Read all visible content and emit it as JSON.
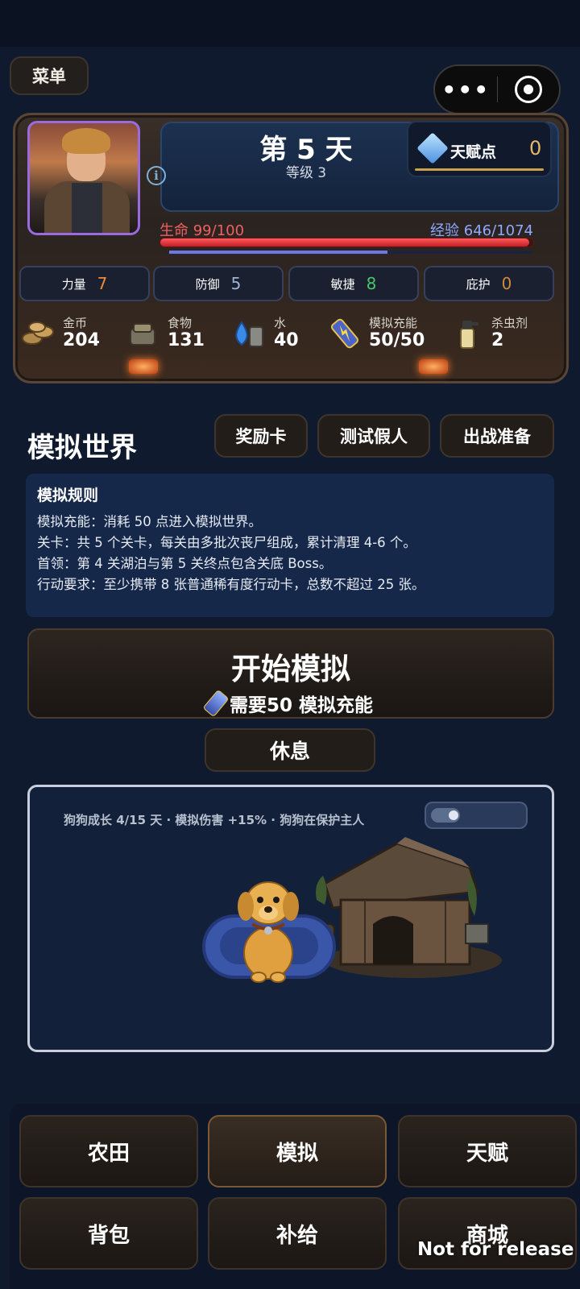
{
  "header": {
    "menu_label": "菜单"
  },
  "player": {
    "day": "第 5 天",
    "level": "等级 3",
    "talent_label": "天赋点",
    "talent_value": "0",
    "hp_label": "生命 99/100",
    "xp_label": "经验 646/1074",
    "hp_current": 99,
    "hp_max": 100,
    "xp_current": 646,
    "xp_max": 1074
  },
  "stats": [
    {
      "label": "力量",
      "value": "7",
      "color": "#f08a3a"
    },
    {
      "label": "防御",
      "value": "5",
      "color": "#9fb4d6"
    },
    {
      "label": "敏捷",
      "value": "8",
      "color": "#4ac46a"
    },
    {
      "label": "庇护",
      "value": "0",
      "color": "#d08a3a"
    }
  ],
  "resources": [
    {
      "label": "金币",
      "value": "204",
      "icon": "coins-icon"
    },
    {
      "label": "食物",
      "value": "131",
      "icon": "food-icon"
    },
    {
      "label": "水",
      "value": "40",
      "icon": "water-icon"
    },
    {
      "label": "模拟充能",
      "value": "50/50",
      "icon": "battery-icon"
    },
    {
      "label": "杀虫剂",
      "value": "2",
      "icon": "spray-icon"
    }
  ],
  "section": {
    "title": "模拟世界",
    "buttons": [
      "奖励卡",
      "测试假人",
      "出战准备"
    ]
  },
  "rules": {
    "heading": "模拟规则",
    "lines": [
      "模拟充能：消耗 50 点进入模拟世界。",
      "关卡：共 5 个关卡，每关由多批次丧尸组成，累计清理 4-6 个。",
      "首领：第 4 关湖泊与第 5 关终点包含关底 Boss。",
      "行动要求：至少携带 8 张普通稀有度行动卡，总数不超过 25 张。"
    ]
  },
  "start": {
    "title": "开始模拟",
    "subtitle": "需要50 模拟充能"
  },
  "rest_label": "休息",
  "dog": {
    "status": "狗狗成长 4/15 天 · 模拟伤害 +15% · 狗狗在保护主人"
  },
  "nav": [
    "农田",
    "模拟",
    "天赋",
    "背包",
    "补给",
    "商城"
  ],
  "nav_active": "模拟",
  "watermark": "Not for release"
}
